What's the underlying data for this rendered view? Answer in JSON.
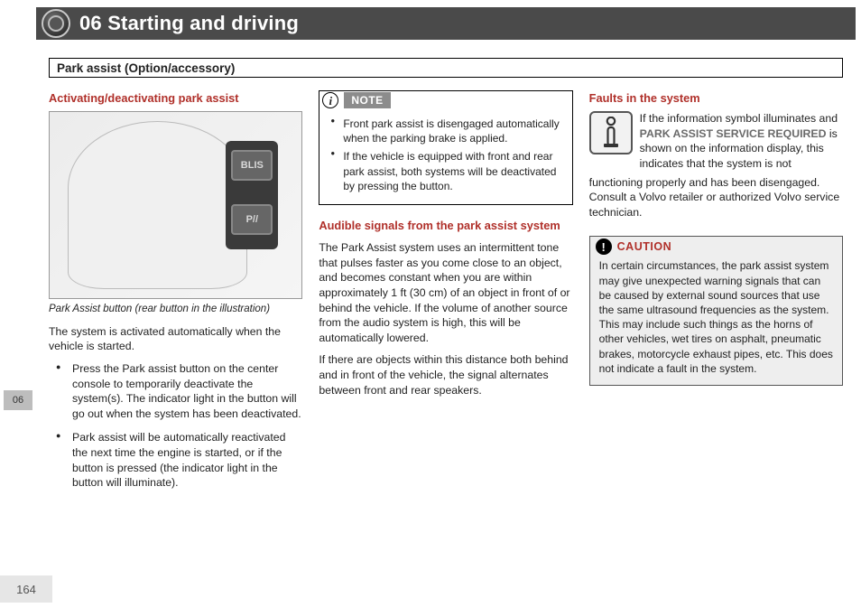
{
  "header": {
    "chapter_num": "06",
    "chapter_title": "Starting and driving"
  },
  "section_title": "Park assist (Option/accessory)",
  "side_tab": {
    "active_label": "06"
  },
  "page_number": "164",
  "col1": {
    "heading": "Activating/deactivating park assist",
    "illus_btn1": "BLIS",
    "illus_btn2": "P//",
    "caption": "Park Assist button (rear button in the illustration)",
    "intro": "The system is activated automatically when the vehicle is started.",
    "bullets": [
      "Press the Park assist button on the center console to temporarily deactivate the system(s). The indicator light in the button will go out when the system has been deactivated.",
      "Park assist will be automatically reactivated the next time the engine is started, or if the button is pressed (the indicator light in the button will illuminate)."
    ]
  },
  "col2": {
    "note": {
      "label": "NOTE",
      "items": [
        "Front park assist is disengaged automatically when the parking brake is applied.",
        "If the vehicle is equipped with front and rear park assist, both systems will be deactivated by pressing the button."
      ]
    },
    "heading": "Audible signals from the park assist system",
    "p1": "The Park Assist system uses an intermittent tone that pulses faster as you come close to an object, and becomes constant when you are within approximately 1 ft (30 cm) of an object in front of or behind the vehicle. If the volume of another source from the audio system is high, this will be automatically lowered.",
    "p2": "If there are objects within this distance both behind and in front of the vehicle, the signal alternates between front and rear speakers."
  },
  "col3": {
    "heading": "Faults in the system",
    "faults_text_pre": "If the information symbol illuminates and ",
    "faults_text_bold": "PARK ASSIST SERVICE REQUIRED",
    "faults_text_post1": " is shown on the information display, this indicates that the system is not ",
    "faults_text_post2": "functioning properly and has been disengaged. Consult a Volvo retailer or authorized Volvo service technician.",
    "caution": {
      "label": "CAUTION",
      "body": "In certain circumstances, the park assist system may give unexpected warning signals that can be caused by external sound sources that use the same ultrasound frequencies as the system. This may include such things as the horns of other vehicles, wet tires on asphalt, pneumatic brakes, motorcycle exhaust pipes, etc. This does not indicate a fault in the system."
    }
  }
}
